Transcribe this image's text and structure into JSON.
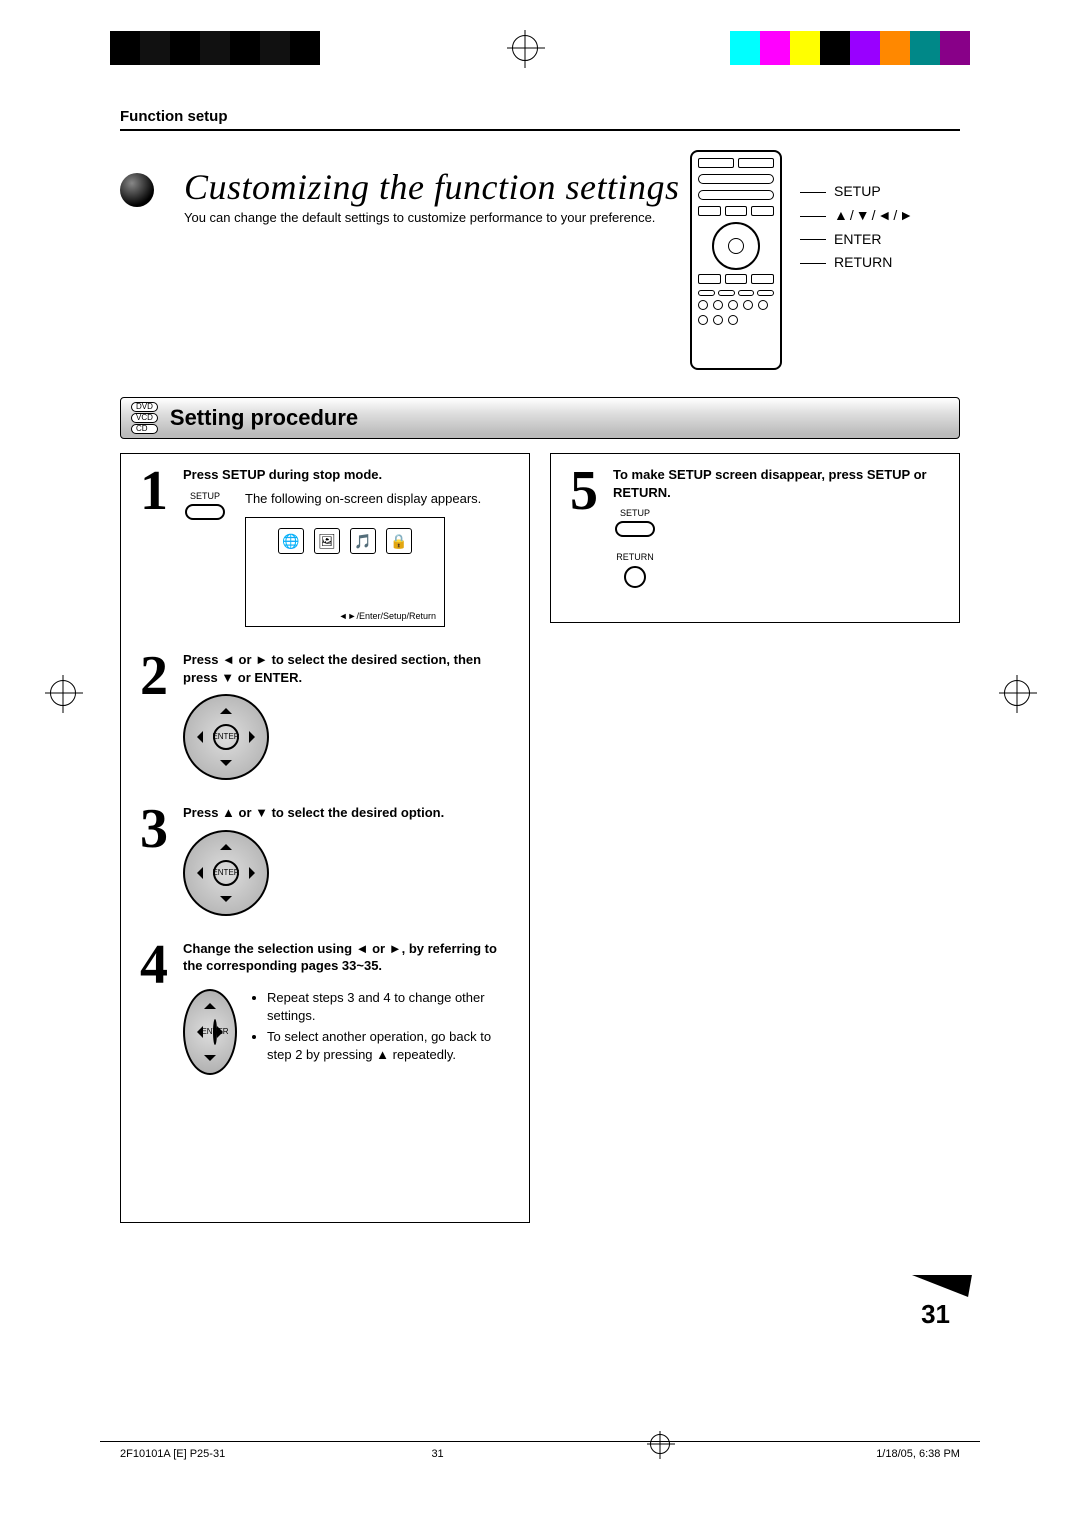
{
  "header": {
    "section": "Function setup"
  },
  "title": "Customizing the function settings",
  "intro": "You can change the default settings to customize performance to your preference.",
  "remote_labels": {
    "setup": "SETUP",
    "arrows": "▲/▼/◄/►",
    "enter": "ENTER",
    "return": "RETURN"
  },
  "disc_badges": [
    "DVD",
    "VCD",
    "CD"
  ],
  "setting_heading": "Setting procedure",
  "steps": {
    "s1": {
      "num": "1",
      "head": "Press SETUP during stop mode.",
      "body": "The following on-screen display appears.",
      "btn": "SETUP",
      "screen_caption": "◄►/Enter/Setup/Return"
    },
    "s2": {
      "num": "2",
      "head": "Press ◄ or ► to select the desired section, then press ▼ or ENTER."
    },
    "s3": {
      "num": "3",
      "head": "Press ▲ or ▼ to select the desired option."
    },
    "s4": {
      "num": "4",
      "head": "Change the selection using ◄ or ►, by referring to the corresponding pages 33~35.",
      "bullet1": "Repeat steps 3 and 4 to change other settings.",
      "bullet2": "To select another operation, go back to step 2 by pressing ▲ repeatedly."
    },
    "s5": {
      "num": "5",
      "head": "To make SETUP screen disappear, press SETUP or RETURN.",
      "btn_setup": "SETUP",
      "btn_return": "RETURN"
    }
  },
  "page_number": "31",
  "footer": {
    "left": "2F10101A [E] P25-31",
    "mid": "31",
    "right": "1/18/05, 6:38 PM"
  }
}
